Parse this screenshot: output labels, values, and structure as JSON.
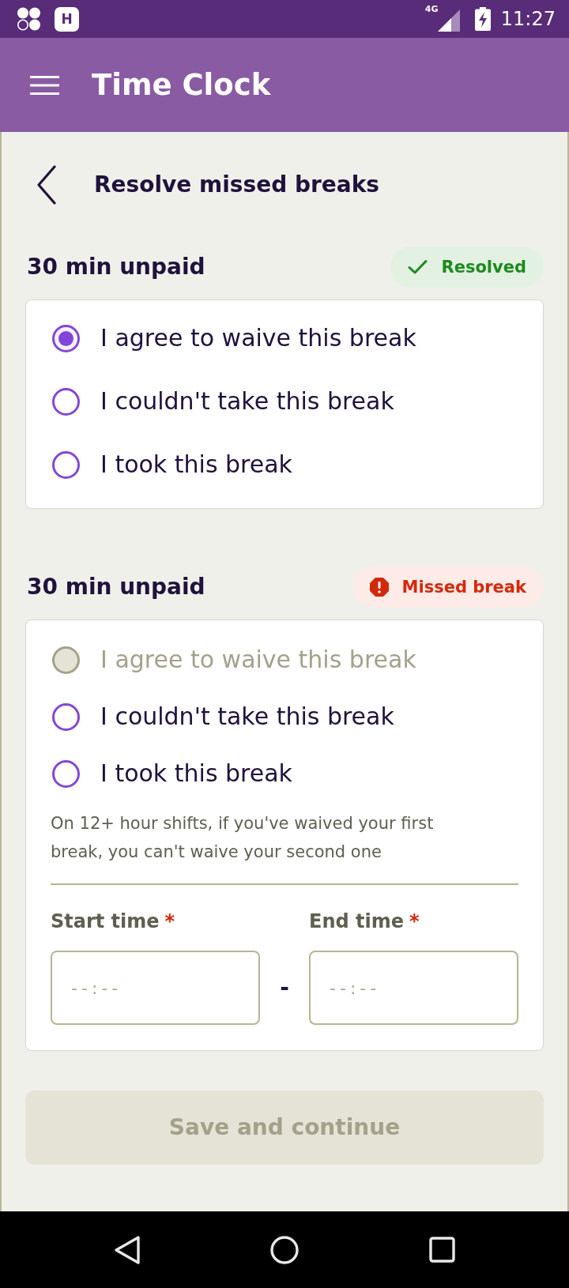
{
  "status_bar": {
    "notification_icons": [
      {
        "kind": "clover"
      },
      {
        "kind": "letter",
        "letter": "H"
      }
    ],
    "network": "4G",
    "time": "11:27"
  },
  "app_bar": {
    "title": "Time Clock"
  },
  "page": {
    "title": "Resolve missed breaks"
  },
  "breaks": [
    {
      "title": "30 min unpaid",
      "status": {
        "kind": "resolved",
        "label": "Resolved"
      },
      "options": [
        {
          "label": "I agree to waive this break",
          "selected": true,
          "disabled": false
        },
        {
          "label": "I couldn't take this break",
          "selected": false,
          "disabled": false
        },
        {
          "label": "I took this break",
          "selected": false,
          "disabled": false
        }
      ]
    },
    {
      "title": "30 min unpaid",
      "status": {
        "kind": "missed",
        "label": "Missed break"
      },
      "options": [
        {
          "label": "I agree to waive this break",
          "selected": false,
          "disabled": true
        },
        {
          "label": "I couldn't take this break",
          "selected": false,
          "disabled": false
        },
        {
          "label": "I took this break",
          "selected": false,
          "disabled": false
        }
      ],
      "note": "On 12+ hour shifts, if you've waived your first break, you can't waive your second one",
      "time_fields": [
        {
          "label": "Start time",
          "required_mark": "*",
          "placeholder": "--:--"
        },
        {
          "label": "End time",
          "required_mark": "*",
          "placeholder": "--:--"
        }
      ],
      "range_separator": "-"
    }
  ],
  "save_button": {
    "label": "Save and continue",
    "disabled": true
  }
}
